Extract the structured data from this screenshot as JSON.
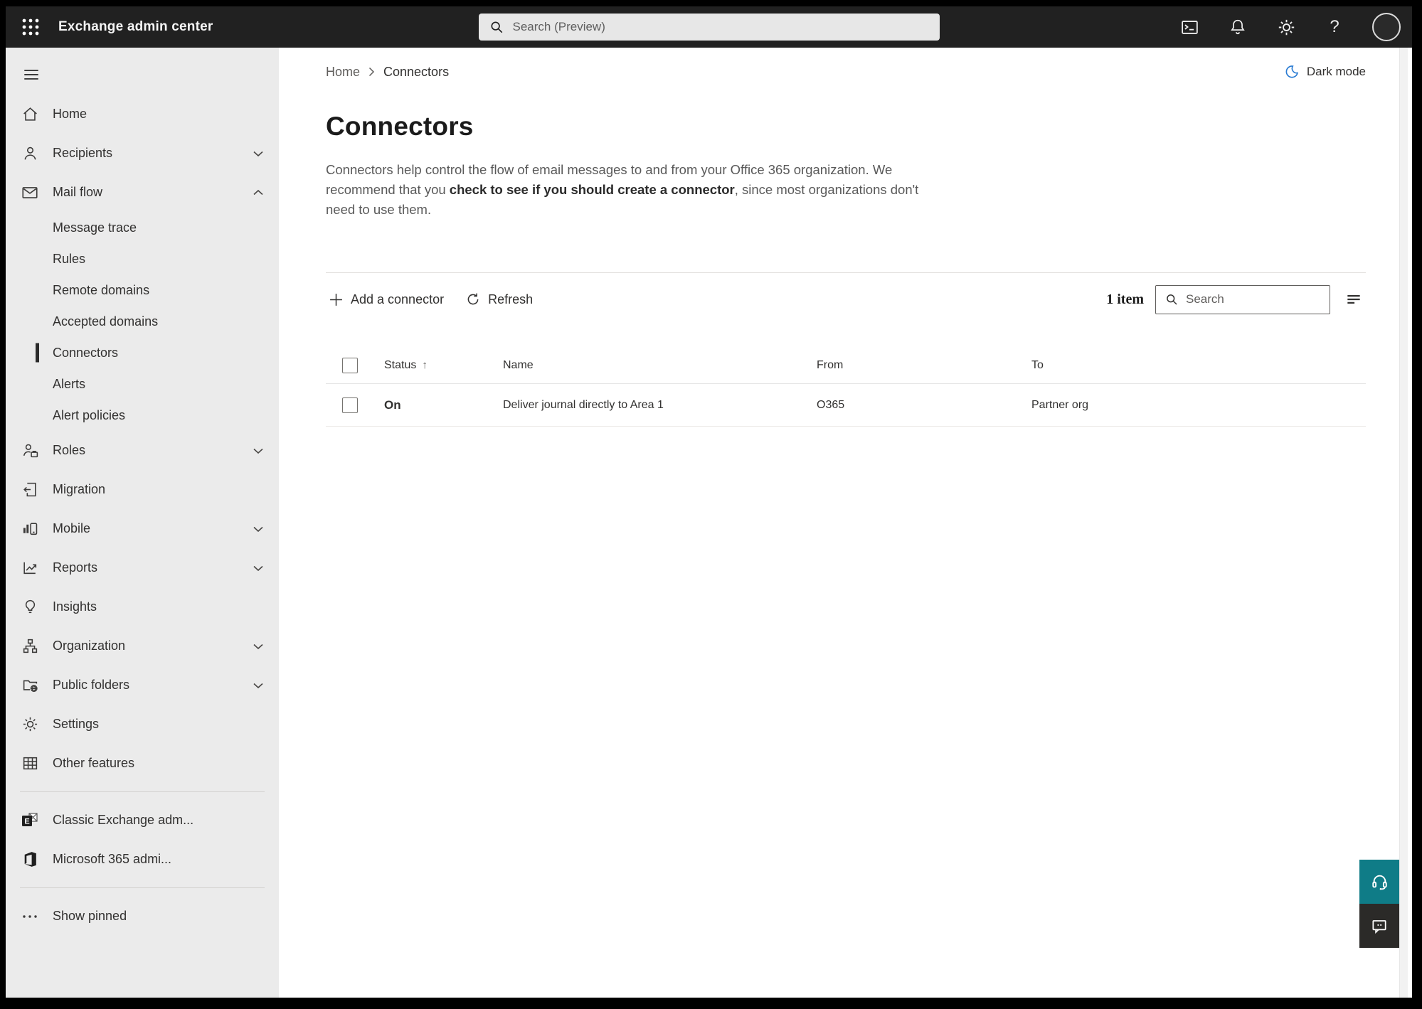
{
  "topbar": {
    "app_title": "Exchange admin center",
    "search_placeholder": "Search (Preview)"
  },
  "sidebar": {
    "items": [
      {
        "label": "Home"
      },
      {
        "label": "Recipients"
      },
      {
        "label": "Mail flow"
      },
      {
        "label": "Message trace"
      },
      {
        "label": "Rules"
      },
      {
        "label": "Remote domains"
      },
      {
        "label": "Accepted domains"
      },
      {
        "label": "Connectors",
        "selected": true
      },
      {
        "label": "Alerts"
      },
      {
        "label": "Alert policies"
      },
      {
        "label": "Roles"
      },
      {
        "label": "Migration"
      },
      {
        "label": "Mobile"
      },
      {
        "label": "Reports"
      },
      {
        "label": "Insights"
      },
      {
        "label": "Organization"
      },
      {
        "label": "Public folders"
      },
      {
        "label": "Settings"
      },
      {
        "label": "Other features"
      },
      {
        "label": "Classic Exchange adm..."
      },
      {
        "label": "Microsoft 365 admi..."
      },
      {
        "label": "Show pinned"
      }
    ]
  },
  "breadcrumb": {
    "home": "Home",
    "current": "Connectors"
  },
  "dark_mode": {
    "label": "Dark mode"
  },
  "page": {
    "title": "Connectors",
    "description_pre": "Connectors help control the flow of email messages to and from your Office 365 organization. We recommend that you ",
    "description_link": "check to see if you should create a connector",
    "description_post": ", since most organizations don't need to use them."
  },
  "toolbar": {
    "add_label": "Add a connector",
    "refresh_label": "Refresh",
    "count_label": "1 item",
    "search_placeholder": "Search"
  },
  "table": {
    "headers": {
      "status": "Status",
      "name": "Name",
      "from": "From",
      "to": "To"
    },
    "sort_indicator": "↑",
    "rows": [
      {
        "status": "On",
        "name": "Deliver journal directly to Area 1",
        "from": "O365",
        "to": "Partner org"
      }
    ]
  },
  "colors": {
    "topbar_bg": "#212121",
    "sidebar_bg": "#ebebeb",
    "selected_marker": "#2b2b2b",
    "text_primary": "#323130",
    "text_secondary": "#605e5c",
    "accent_blue": "#2b7cd3",
    "help_teal": "#0f7c87",
    "feedback_dark": "#2b2a28",
    "divider": "#e1dfdd"
  },
  "icons": {
    "app-launcher-icon": "3x3 dot grid",
    "terminal-icon": "console window with prompt",
    "bell-icon": "notification bell outline",
    "gear-icon": "settings gear outline",
    "help-icon": "question mark",
    "avatar": "empty profile circle",
    "menu-icon": "hamburger three lines",
    "home-icon": "house outline",
    "recipients-icon": "person outline",
    "mail-flow-icon": "envelope outline",
    "roles-icon": "person with briefcase",
    "migration-icon": "document with arrow",
    "mobile-icon": "bar chart with phone",
    "reports-icon": "line chart with arrow",
    "insights-icon": "lightbulb outline",
    "organization-icon": "org chart boxes",
    "public-folders-icon": "folder with globe",
    "settings-icon": "gear outline",
    "other-features-icon": "table grid",
    "classic-exchange-icon": "Exchange logo square",
    "microsoft-365-icon": "Office logo",
    "show-pinned-icon": "horizontal ellipsis",
    "breadcrumb-chevron-icon": "chevron right",
    "dark-mode-icon": "blue crescent moon",
    "add-icon": "thin plus",
    "refresh-icon": "circular arrow",
    "search-icon": "magnifier",
    "filter-icon": "three horizontal lines",
    "sort-asc-icon": "up arrow",
    "chevron-down-icon": "chevron down",
    "chevron-up-icon": "chevron up",
    "help-button-icon": "headset",
    "feedback-button-icon": "speech bubble with dots"
  }
}
